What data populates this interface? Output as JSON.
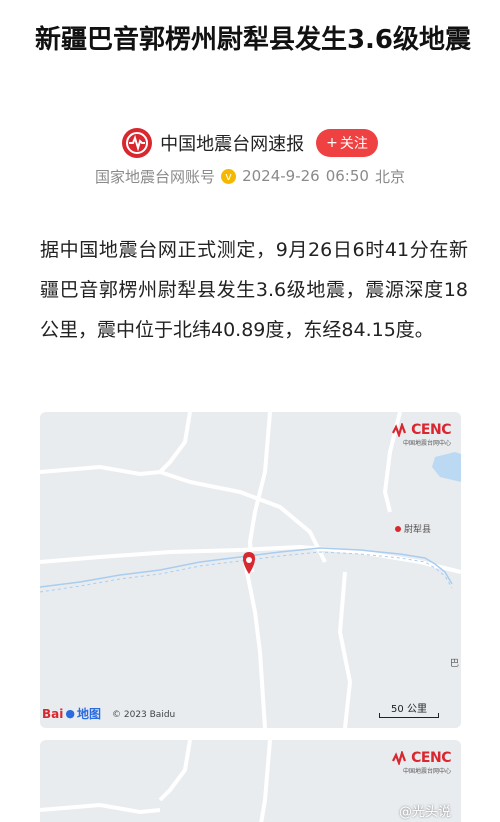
{
  "article": {
    "title": "新疆巴音郭楞州尉犁县发生3.6级地震",
    "source": {
      "name": "中国地震台网速报",
      "follow_label": "关注",
      "account_type": "国家地震台网账号",
      "date": "2024-9-26",
      "time": "06:50",
      "location": "北京"
    },
    "body": "据中国地震台网正式测定，9月26日6时41分在新疆巴音郭楞州尉犁县发生3.6级地震，震源深度18公里，震中位于北纬40.89度，东经84.15度。"
  },
  "map1": {
    "badge_text": "CENC",
    "badge_subtext": "中国地震台网中心",
    "county_label": "尉犁县",
    "edge_label": "巴",
    "baidu_bai": "Bai",
    "baidu_ditu": "地图",
    "copyright": "© 2023 Baidu",
    "scale_label": "50 公里"
  },
  "map2": {
    "badge_text": "CENC",
    "badge_subtext": "中国地震台网中心",
    "watermark": "@光头说"
  },
  "colors": {
    "accent_red": "#d8272f",
    "follow_red": "#f04142",
    "map_bg": "#e9ecef",
    "river": "#a9cdef",
    "boundary": "#ffffff"
  }
}
